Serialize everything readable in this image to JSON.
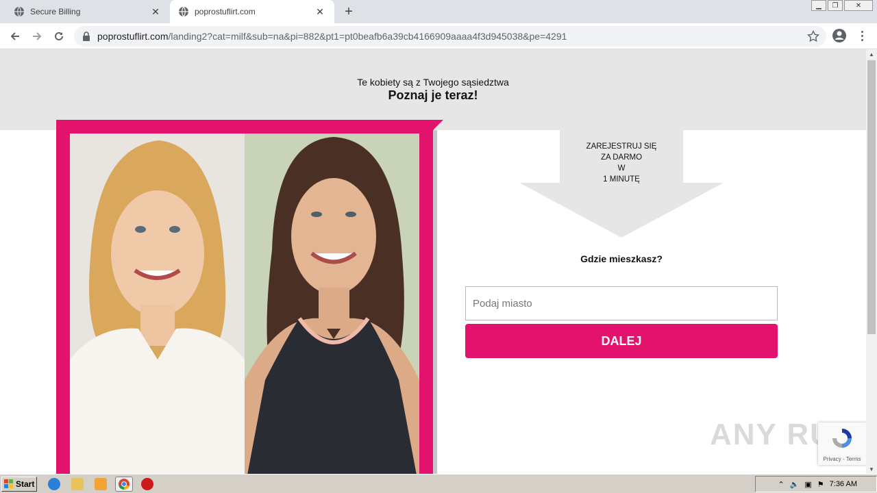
{
  "browser": {
    "tabs": [
      {
        "title": "Secure Billing"
      },
      {
        "title": "poprostuflirt.com"
      }
    ],
    "url_domain": "poprostuflirt.com",
    "url_path": "/landing2?cat=milf&sub=na&pi=882&pt1=pt0beafb6a39cb4166909aaaa4f3d945038&pe=4291"
  },
  "page": {
    "subline": "Te kobiety są z Twojego sąsiedztwa",
    "headline": "Poznaj je teraz!",
    "arrow_lines": [
      "ZAREJESTRUJ SIĘ",
      "ZA DARMO",
      "W",
      "1 MINUTĘ"
    ],
    "question": "Gdzie mieszkasz?",
    "city_placeholder": "Podaj miasto",
    "next_label": "DALEJ",
    "recaptcha_links": "Privacy - Terms",
    "watermark": "ANY RUN"
  },
  "taskbar": {
    "start_label": "Start",
    "clock": "7:36 AM"
  },
  "colors": {
    "accent": "#e3126c",
    "hero_bg": "#e6e6e6"
  }
}
